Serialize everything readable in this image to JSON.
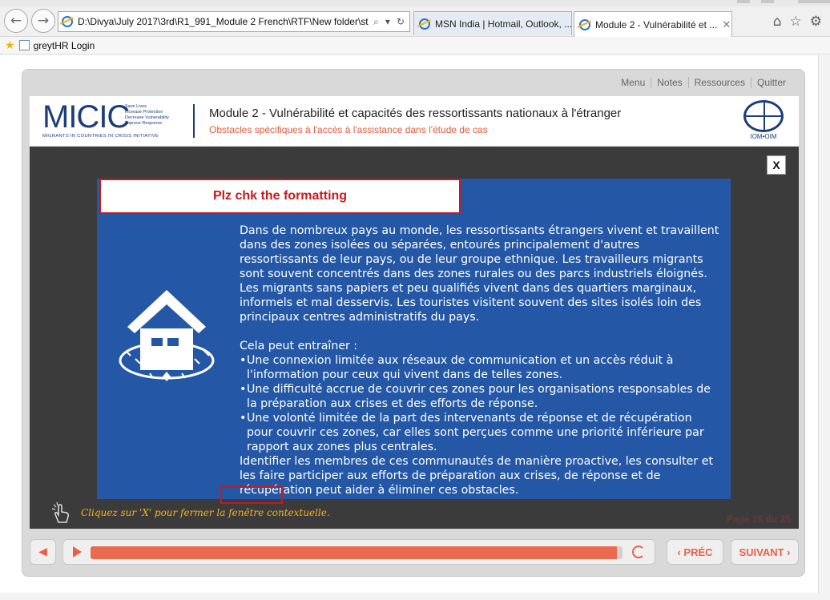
{
  "browser": {
    "address": "D:\\Divya\\July 2017\\3rd\\R1_991_Module 2 French\\RTF\\New folder\\sto",
    "tabs": [
      {
        "label": "MSN India | Hotmail, Outlook, ..."
      },
      {
        "label": "Module 2 - Vulnérabilité et ..."
      }
    ],
    "tab_close": "✕",
    "favorites": [
      {
        "label": "greytHR Login"
      }
    ]
  },
  "player": {
    "nav": [
      "Menu",
      "Notes",
      "Ressources",
      "Quitter"
    ],
    "logo": {
      "text": "MICIC",
      "tagline_lines": [
        "Save Lives",
        "Increase Protection",
        "Decrease Vulnerability",
        "Improve Response"
      ],
      "strap": "MIGRANTS IN COUNTRIES IN CRISIS INITIATIVE"
    },
    "module_title": "Module 2 - Vulnérabilité et capacités des ressortissants nationaux à l'étranger",
    "module_subtitle": "Obstacles spécifiques à l'accès à l'assistance dans l'étude de cas",
    "iom_label": "IOM•OIM",
    "close_label": "X",
    "annotation": "Plz chk the formatting",
    "popup": {
      "paragraph1": "Dans de nombreux pays au monde, les ressortissants étrangers vivent et travaillent dans des zones isolées ou séparées, entourés principalement d'autres ressortissants de leur pays, ou de leur groupe ethnique. Les travailleurs migrants sont souvent concentrés dans des zones rurales ou des parcs industriels éloignés. Les migrants sans papiers et peu qualifiés vivent dans des quartiers marginaux, informels et mal desservis. Les touristes visitent souvent des sites isolés loin des principaux centres administratifs du pays.",
      "intro": "Cela peut entraîner :",
      "bullets": [
        "Une connexion limitée aux réseaux de communication et un accès réduit à l'information pour ceux qui vivent dans de telles zones.",
        "Une difficulté accrue de couvrir ces zones pour les organisations responsables de la préparation aux crises et des efforts de réponse.",
        "Une volonté limitée de la part des intervenants de réponse et de récupération pour couvrir ces zones, car elles sont perçues comme une priorité inférieure par rapport aux zones plus centrales."
      ],
      "closing": "Identifier les membres de ces communautés de manière proactive, les consulter et les faire participer aux efforts de préparation aux crises, de réponse et de récupération peut aider à éliminer ces obstacles."
    },
    "hint": "Cliquez sur 'X' pour fermer la fenêtre contextuelle.",
    "page_info": "Page 15 du 25",
    "progress": 0.99,
    "prev_label": "‹ PRÉC",
    "next_label": "SUIVANT ›"
  },
  "colors": {
    "accent": "#e8604a",
    "popup_bg": "#2458a6",
    "brand_blue": "#1d3e7b",
    "annotation_red": "#c8191c",
    "hint_gold": "#f6b21b"
  },
  "icons": [
    "back-arrow-icon",
    "forward-arrow-icon",
    "ie-icon",
    "search-icon",
    "refresh-icon",
    "home-icon",
    "star-icon",
    "gear-icon",
    "house-icon",
    "hand-pointer-icon",
    "speaker-icon",
    "play-icon",
    "replay-icon"
  ]
}
